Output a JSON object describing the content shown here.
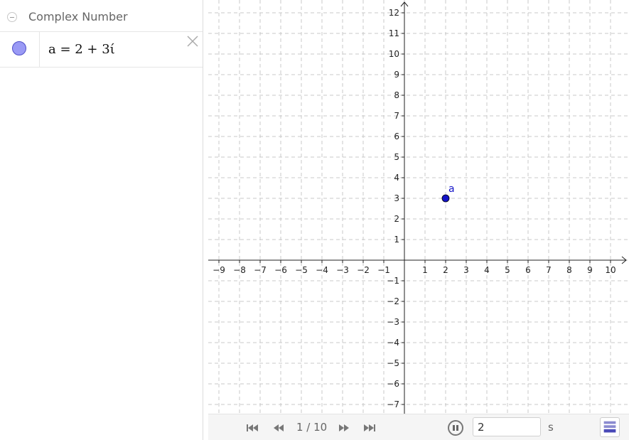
{
  "algebra": {
    "title": "Complex Number",
    "items": [
      {
        "expression": "a = 2 + 3ί",
        "color": "#5050c8"
      }
    ]
  },
  "graphics": {
    "point": {
      "label": "a",
      "x": 2,
      "y": 3,
      "color": "#1414c8"
    },
    "xlim": [
      -9,
      10
    ],
    "ylim": [
      -7,
      12
    ],
    "x_ticks": [
      "−9",
      "−8",
      "−7",
      "−6",
      "−5",
      "−4",
      "−3",
      "−2",
      "−1",
      "1",
      "2",
      "3",
      "4",
      "5",
      "6",
      "7",
      "8",
      "9",
      "10"
    ],
    "y_ticks": [
      "12",
      "11",
      "10",
      "9",
      "8",
      "7",
      "6",
      "5",
      "4",
      "3",
      "2",
      "1",
      "−1",
      "−2",
      "−3",
      "−4",
      "−5",
      "−6",
      "−7"
    ],
    "grid": "dashed"
  },
  "playbar": {
    "counter": "1 / 10",
    "speed_value": "2",
    "speed_unit": "s"
  }
}
